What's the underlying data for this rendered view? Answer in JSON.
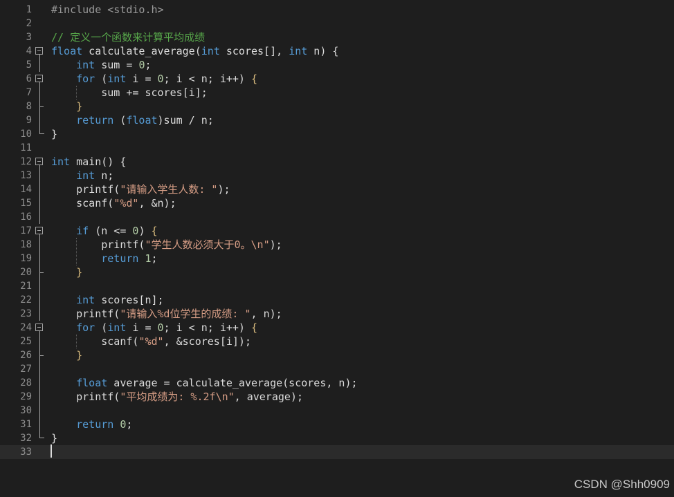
{
  "colors": {
    "background": "#1e1e1e",
    "current_line": "#2b2b2b",
    "line_number": "#8e8e8e",
    "default_text": "#dcdcdc",
    "keyword": "#569cd6",
    "preprocessor": "#9b9b9b",
    "comment": "#57a64a",
    "string": "#d69d85",
    "number": "#b5cea8",
    "function": "#dcdcaa",
    "brace_highlight": "#d7ba7d"
  },
  "lines": [
    {
      "n": "1",
      "tokens": [
        {
          "t": "#include <stdio.h>",
          "c": "pp"
        }
      ]
    },
    {
      "n": "2",
      "tokens": []
    },
    {
      "n": "3",
      "tokens": [
        {
          "t": "// 定义一个函数来计算平均成绩",
          "c": "cm"
        }
      ]
    },
    {
      "n": "4",
      "tokens": [
        {
          "t": "float",
          "c": "kw"
        },
        {
          "t": " calculate_average(",
          "c": "tx"
        },
        {
          "t": "int",
          "c": "kw"
        },
        {
          "t": " scores[], ",
          "c": "tx"
        },
        {
          "t": "int",
          "c": "kw"
        },
        {
          "t": " n) {",
          "c": "tx"
        }
      ]
    },
    {
      "n": "5",
      "tokens": [
        {
          "t": "    ",
          "c": "tx"
        },
        {
          "t": "int",
          "c": "kw"
        },
        {
          "t": " sum = ",
          "c": "tx"
        },
        {
          "t": "0",
          "c": "nm"
        },
        {
          "t": ";",
          "c": "tx"
        }
      ]
    },
    {
      "n": "6",
      "tokens": [
        {
          "t": "    ",
          "c": "tx"
        },
        {
          "t": "for",
          "c": "kw"
        },
        {
          "t": " (",
          "c": "tx"
        },
        {
          "t": "int",
          "c": "kw"
        },
        {
          "t": " i = ",
          "c": "tx"
        },
        {
          "t": "0",
          "c": "nm"
        },
        {
          "t": "; i < n; i++) ",
          "c": "tx"
        },
        {
          "t": "{",
          "c": "br"
        }
      ]
    },
    {
      "n": "7",
      "tokens": [
        {
          "t": "        sum += scores[i];",
          "c": "tx"
        }
      ]
    },
    {
      "n": "8",
      "tokens": [
        {
          "t": "    ",
          "c": "tx"
        },
        {
          "t": "}",
          "c": "br"
        }
      ]
    },
    {
      "n": "9",
      "tokens": [
        {
          "t": "    ",
          "c": "tx"
        },
        {
          "t": "return",
          "c": "kw"
        },
        {
          "t": " (",
          "c": "tx"
        },
        {
          "t": "float",
          "c": "kw"
        },
        {
          "t": ")sum / n;",
          "c": "tx"
        }
      ]
    },
    {
      "n": "10",
      "tokens": [
        {
          "t": "}",
          "c": "tx"
        }
      ]
    },
    {
      "n": "11",
      "tokens": []
    },
    {
      "n": "12",
      "tokens": [
        {
          "t": "int",
          "c": "kw"
        },
        {
          "t": " main() {",
          "c": "tx"
        }
      ]
    },
    {
      "n": "13",
      "tokens": [
        {
          "t": "    ",
          "c": "tx"
        },
        {
          "t": "int",
          "c": "kw"
        },
        {
          "t": " n;",
          "c": "tx"
        }
      ]
    },
    {
      "n": "14",
      "tokens": [
        {
          "t": "    printf(",
          "c": "tx"
        },
        {
          "t": "\"请输入学生人数: \"",
          "c": "st"
        },
        {
          "t": ");",
          "c": "tx"
        }
      ]
    },
    {
      "n": "15",
      "tokens": [
        {
          "t": "    scanf(",
          "c": "tx"
        },
        {
          "t": "\"%d\"",
          "c": "st"
        },
        {
          "t": ", &n);",
          "c": "tx"
        }
      ]
    },
    {
      "n": "16",
      "tokens": []
    },
    {
      "n": "17",
      "tokens": [
        {
          "t": "    ",
          "c": "tx"
        },
        {
          "t": "if",
          "c": "kw"
        },
        {
          "t": " (n <= ",
          "c": "tx"
        },
        {
          "t": "0",
          "c": "nm"
        },
        {
          "t": ") ",
          "c": "tx"
        },
        {
          "t": "{",
          "c": "br"
        }
      ]
    },
    {
      "n": "18",
      "tokens": [
        {
          "t": "        printf(",
          "c": "tx"
        },
        {
          "t": "\"学生人数必须大于0。\\n\"",
          "c": "st"
        },
        {
          "t": ");",
          "c": "tx"
        }
      ]
    },
    {
      "n": "19",
      "tokens": [
        {
          "t": "        ",
          "c": "tx"
        },
        {
          "t": "return",
          "c": "kw"
        },
        {
          "t": " ",
          "c": "tx"
        },
        {
          "t": "1",
          "c": "nm"
        },
        {
          "t": ";",
          "c": "tx"
        }
      ]
    },
    {
      "n": "20",
      "tokens": [
        {
          "t": "    ",
          "c": "tx"
        },
        {
          "t": "}",
          "c": "br"
        }
      ]
    },
    {
      "n": "21",
      "tokens": []
    },
    {
      "n": "22",
      "tokens": [
        {
          "t": "    ",
          "c": "tx"
        },
        {
          "t": "int",
          "c": "kw"
        },
        {
          "t": " scores[n];",
          "c": "tx"
        }
      ]
    },
    {
      "n": "23",
      "tokens": [
        {
          "t": "    printf(",
          "c": "tx"
        },
        {
          "t": "\"请输入%d位学生的成绩: \"",
          "c": "st"
        },
        {
          "t": ", n);",
          "c": "tx"
        }
      ]
    },
    {
      "n": "24",
      "tokens": [
        {
          "t": "    ",
          "c": "tx"
        },
        {
          "t": "for",
          "c": "kw"
        },
        {
          "t": " (",
          "c": "tx"
        },
        {
          "t": "int",
          "c": "kw"
        },
        {
          "t": " i = ",
          "c": "tx"
        },
        {
          "t": "0",
          "c": "nm"
        },
        {
          "t": "; i < n; i++) ",
          "c": "tx"
        },
        {
          "t": "{",
          "c": "br"
        }
      ]
    },
    {
      "n": "25",
      "tokens": [
        {
          "t": "        scanf(",
          "c": "tx"
        },
        {
          "t": "\"%d\"",
          "c": "st"
        },
        {
          "t": ", &scores[i]);",
          "c": "tx"
        }
      ]
    },
    {
      "n": "26",
      "tokens": [
        {
          "t": "    ",
          "c": "tx"
        },
        {
          "t": "}",
          "c": "br"
        }
      ]
    },
    {
      "n": "27",
      "tokens": []
    },
    {
      "n": "28",
      "tokens": [
        {
          "t": "    ",
          "c": "tx"
        },
        {
          "t": "float",
          "c": "kw"
        },
        {
          "t": " average = calculate_average(scores, n);",
          "c": "tx"
        }
      ]
    },
    {
      "n": "29",
      "tokens": [
        {
          "t": "    printf(",
          "c": "tx"
        },
        {
          "t": "\"平均成绩为: %.2f\\n\"",
          "c": "st"
        },
        {
          "t": ", average);",
          "c": "tx"
        }
      ]
    },
    {
      "n": "30",
      "tokens": []
    },
    {
      "n": "31",
      "tokens": [
        {
          "t": "    ",
          "c": "tx"
        },
        {
          "t": "return",
          "c": "kw"
        },
        {
          "t": " ",
          "c": "tx"
        },
        {
          "t": "0",
          "c": "nm"
        },
        {
          "t": ";",
          "c": "tx"
        }
      ]
    },
    {
      "n": "32",
      "tokens": [
        {
          "t": "}",
          "c": "tx"
        }
      ]
    },
    {
      "n": "33",
      "tokens": []
    }
  ],
  "watermark": "CSDN @Shh0909"
}
